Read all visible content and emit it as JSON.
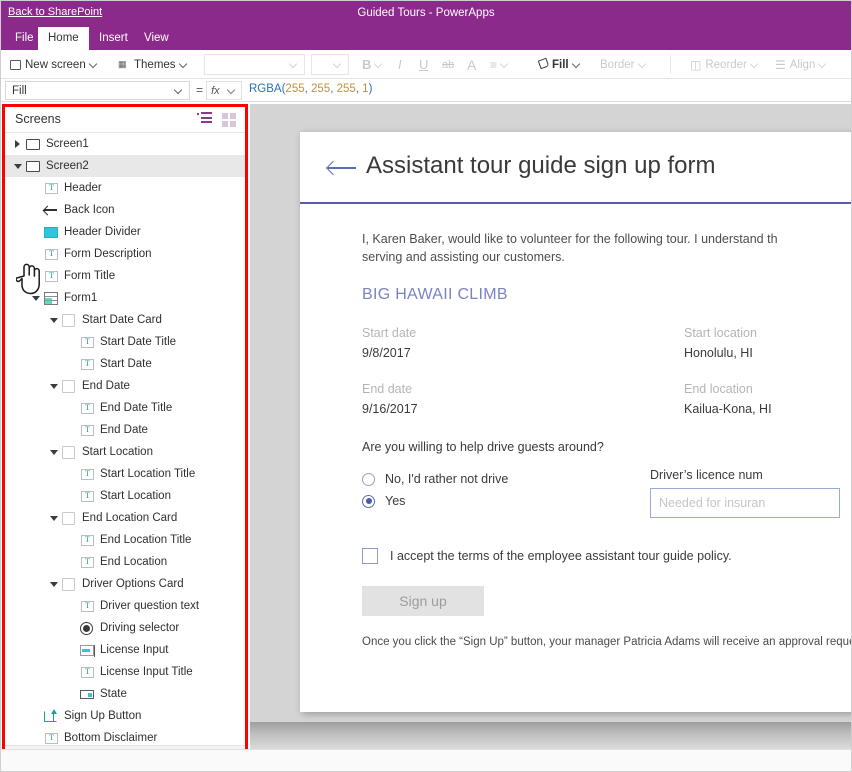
{
  "titlebar": {
    "back_link": "Back to SharePoint",
    "app_title": "Guided Tours - PowerApps",
    "brand_color": "#8c2a8c"
  },
  "ribbon": {
    "tabs": [
      {
        "label": "File",
        "active": false
      },
      {
        "label": "Home",
        "active": true
      },
      {
        "label": "Insert",
        "active": false
      },
      {
        "label": "View",
        "active": false
      }
    ]
  },
  "toolbar": {
    "new_screen": "New screen",
    "themes": "Themes",
    "bold": "B",
    "italic": "I",
    "underline": "U",
    "strikethrough": "ab",
    "font_color": "A",
    "align": "≡",
    "fill": "Fill",
    "border": "Border",
    "reorder": "Reorder",
    "align_menu": "Align"
  },
  "formula_bar": {
    "property": "Fill",
    "equals": "=",
    "fx": "fx",
    "formula_prefix": "RGBA(",
    "formula_args": "255, 255, 255, 1",
    "formula_suffix": ")",
    "formula_full": "RGBA(255, 255, 255, 1)",
    "value_r": "255",
    "value_g": "255",
    "value_b": "255",
    "value_a": "1"
  },
  "screens_panel": {
    "title": "Screens",
    "highlight_color": "#ff0000",
    "list_view_icon": "list-view-icon",
    "grid_view_icon": "thumbnail-view-icon",
    "status_label": "Screen2",
    "tree": [
      {
        "label": "Screen1",
        "depth": 0,
        "icon": "screen-icon",
        "arrow": "right",
        "selected": false
      },
      {
        "label": "Screen2",
        "depth": 0,
        "icon": "screen-icon",
        "arrow": "down",
        "selected": true
      },
      {
        "label": "Header",
        "depth": 1,
        "icon": "text-label-icon",
        "arrow": "none",
        "selected": false
      },
      {
        "label": "Back Icon",
        "depth": 1,
        "icon": "back-arrow-icon",
        "arrow": "none",
        "selected": false
      },
      {
        "label": "Header Divider",
        "depth": 1,
        "icon": "rectangle-icon",
        "arrow": "none",
        "selected": false
      },
      {
        "label": "Form Description",
        "depth": 1,
        "icon": "text-label-icon",
        "arrow": "none",
        "selected": false
      },
      {
        "label": "Form Title",
        "depth": 1,
        "icon": "text-label-icon",
        "arrow": "none",
        "selected": false
      },
      {
        "label": "Form1",
        "depth": 1,
        "icon": "form-icon",
        "arrow": "down",
        "selected": false
      },
      {
        "label": "Start Date Card",
        "depth": 2,
        "icon": "card-icon",
        "arrow": "down",
        "selected": false
      },
      {
        "label": "Start Date Title",
        "depth": 3,
        "icon": "text-label-icon",
        "arrow": "none",
        "selected": false
      },
      {
        "label": "Start Date",
        "depth": 3,
        "icon": "text-label-icon",
        "arrow": "none",
        "selected": false
      },
      {
        "label": "End Date",
        "depth": 2,
        "icon": "card-icon",
        "arrow": "down",
        "selected": false
      },
      {
        "label": "End Date Title",
        "depth": 3,
        "icon": "text-label-icon",
        "arrow": "none",
        "selected": false
      },
      {
        "label": "End Date",
        "depth": 3,
        "icon": "text-label-icon",
        "arrow": "none",
        "selected": false
      },
      {
        "label": "Start Location",
        "depth": 2,
        "icon": "card-icon",
        "arrow": "down",
        "selected": false
      },
      {
        "label": "Start Location Title",
        "depth": 3,
        "icon": "text-label-icon",
        "arrow": "none",
        "selected": false
      },
      {
        "label": "Start Location",
        "depth": 3,
        "icon": "text-label-icon",
        "arrow": "none",
        "selected": false
      },
      {
        "label": "End Location Card",
        "depth": 2,
        "icon": "card-icon",
        "arrow": "down",
        "selected": false
      },
      {
        "label": "End Location Title",
        "depth": 3,
        "icon": "text-label-icon",
        "arrow": "none",
        "selected": false
      },
      {
        "label": "End Location",
        "depth": 3,
        "icon": "text-label-icon",
        "arrow": "none",
        "selected": false
      },
      {
        "label": "Driver Options Card",
        "depth": 2,
        "icon": "card-icon",
        "arrow": "down",
        "selected": false
      },
      {
        "label": "Driver question text",
        "depth": 3,
        "icon": "text-label-icon",
        "arrow": "none",
        "selected": false
      },
      {
        "label": "Driving selector",
        "depth": 3,
        "icon": "radio-button-icon",
        "arrow": "none",
        "selected": false
      },
      {
        "label": "License Input",
        "depth": 3,
        "icon": "text-input-icon",
        "arrow": "none",
        "selected": false
      },
      {
        "label": "License Input Title",
        "depth": 3,
        "icon": "text-label-icon",
        "arrow": "none",
        "selected": false
      },
      {
        "label": "State",
        "depth": 3,
        "icon": "dropdown-icon",
        "arrow": "none",
        "selected": false
      },
      {
        "label": "Sign Up Button",
        "depth": 1,
        "icon": "button-icon",
        "arrow": "none",
        "selected": false
      },
      {
        "label": "Bottom Disclaimer",
        "depth": 1,
        "icon": "text-label-icon",
        "arrow": "none",
        "selected": false
      }
    ]
  },
  "canvas": {
    "form": {
      "back_icon": "back-arrow-icon",
      "title": "Assistant tour guide sign up form",
      "description_line1": "I, Karen Baker, would like to volunteer for the following tour. I understand th",
      "description_line2": "serving and assisting our customers.",
      "tour_title": "BIG HAWAII CLIMB",
      "fields": [
        {
          "label": "Start date",
          "value": "9/8/2017"
        },
        {
          "label": "Start location",
          "value": "Honolulu, HI"
        },
        {
          "label": "End date",
          "value": "9/16/2017"
        },
        {
          "label": "End location",
          "value": "Kailua-Kona, HI"
        }
      ],
      "driver_question": "Are you willing to help drive guests around?",
      "radio_options": [
        {
          "label": "No, I'd rather not drive",
          "selected": false
        },
        {
          "label": "Yes",
          "selected": true
        }
      ],
      "licence_label": "Driver’s licence num",
      "licence_placeholder": "Needed for insuran",
      "accept_label": "I accept the terms of the employee assistant tour guide policy.",
      "signup_button": "Sign up",
      "disclaimer": "Once you click the “Sign Up” button, your manager Patricia Adams will receive an approval request"
    }
  }
}
